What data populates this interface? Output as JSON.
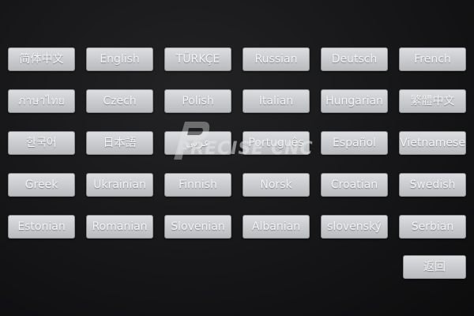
{
  "languages": [
    "简体中文",
    "English",
    "TÜRKÇE",
    "Russian",
    "Deutsch",
    "French",
    "ภาษาไทย",
    "Czech",
    "Polish",
    "Italian",
    "Hungarian",
    "繁體中文",
    "한국어",
    "日本語",
    "عربي",
    "Português",
    "Español",
    "Vietnamese",
    "Greek",
    "Ukrainian",
    "Finnish",
    "Norsk",
    "Croatian",
    "Swedish",
    "Estonian",
    "Romanian",
    "Slovenian",
    "Albanian",
    "slovenský",
    "Serbian"
  ],
  "back_label": "返回",
  "watermark": {
    "text": "PRECISE CNC",
    "icon": "precise-cnc-logo-icon"
  }
}
